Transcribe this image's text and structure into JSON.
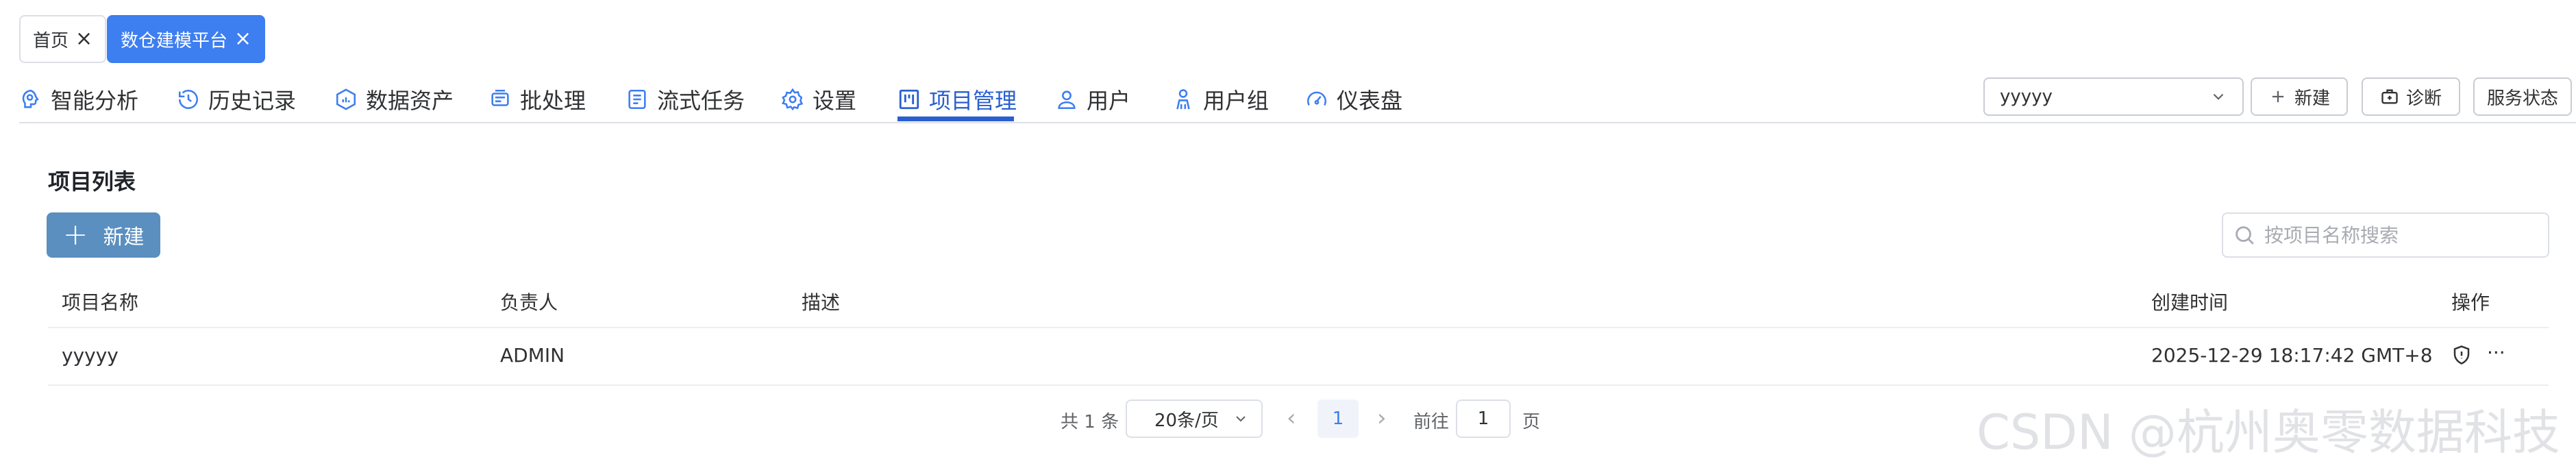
{
  "page_tabs": [
    {
      "label": "首页"
    },
    {
      "label": "数仓建模平台"
    }
  ],
  "close_glyph": "×",
  "nav": [
    {
      "label": "智能分析",
      "icon": "brain-icon"
    },
    {
      "label": "历史记录",
      "icon": "history-icon"
    },
    {
      "label": "数据资产",
      "icon": "data-asset-icon"
    },
    {
      "label": "批处理",
      "icon": "batch-icon"
    },
    {
      "label": "流式任务",
      "icon": "stream-task-icon"
    },
    {
      "label": "设置",
      "icon": "gear-icon"
    },
    {
      "label": "项目管理",
      "icon": "kanban-icon",
      "active": true
    },
    {
      "label": "用户",
      "icon": "user-icon"
    },
    {
      "label": "用户组",
      "icon": "user-group-icon"
    },
    {
      "label": "仪表盘",
      "icon": "dashboard-icon"
    }
  ],
  "toolbar": {
    "project_select_value": "yyyyy",
    "new_label": "新建",
    "diagnose_label": "诊断",
    "service_status_label": "服务状态"
  },
  "main": {
    "title": "项目列表",
    "new_button_label": "新建",
    "search_placeholder": "按项目名称搜索",
    "table": {
      "columns": [
        "项目名称",
        "负责人",
        "描述",
        "创建时间",
        "操作"
      ],
      "rows": [
        {
          "name": "yyyyy",
          "owner": "ADMIN",
          "description": "",
          "created": "2025-12-29 18:17:42 GMT+8",
          "more": "···"
        }
      ]
    }
  },
  "pagination": {
    "total_text": "共 1 条",
    "page_size": "20条/页",
    "prev": "‹",
    "current_page": "1",
    "next": "›",
    "goto_label": "前往",
    "goto_value": "1",
    "page_suffix": "页"
  },
  "watermark": "CSDN @杭州奥零数据科技",
  "colors": {
    "primary": "#3d7ef0",
    "active_nav": "#2a5fd0",
    "new_button": "#5a8fbf"
  }
}
